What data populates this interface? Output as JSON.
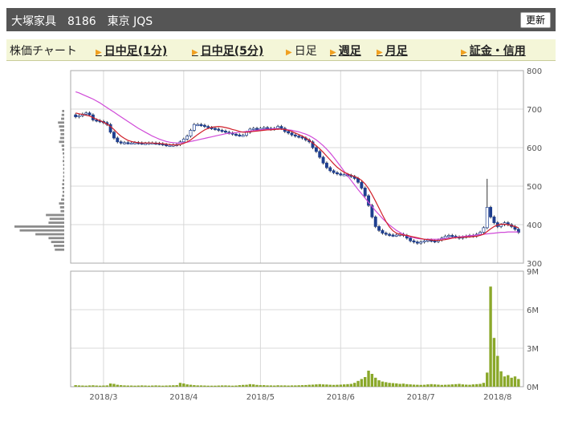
{
  "header": {
    "company": "大塚家具",
    "code": "8186",
    "market": "東京 JQS",
    "update_label": "更新"
  },
  "tabs": [
    {
      "label": "株価チャート",
      "link": false,
      "arrow": false
    },
    {
      "label": "日中足(1分)",
      "link": true,
      "arrow": true
    },
    {
      "label": "日中足(5分)",
      "link": true,
      "arrow": true
    },
    {
      "label": "日足",
      "link": false,
      "arrow": true
    },
    {
      "label": "週足",
      "link": true,
      "arrow": true
    },
    {
      "label": "月足",
      "link": true,
      "arrow": true
    },
    {
      "label": "証金・信用",
      "link": true,
      "arrow": true
    }
  ],
  "colors": {
    "up": "#ffffff",
    "down": "#1f3f8f",
    "ma_short": "#d0202a",
    "ma_long": "#d04ad8",
    "volume": "#8aa82a",
    "volume_profile": "#8c8c8c",
    "grid": "#d8d8d8"
  },
  "chart_data": [
    {
      "type": "candlestick",
      "ylim": [
        300,
        800
      ],
      "yticks": [
        "300",
        "400",
        "500",
        "600",
        "700",
        "800"
      ],
      "xticks": [
        "2018/3",
        "2018/4",
        "2018/5",
        "2018/6",
        "2018/7",
        "2018/8"
      ],
      "close": [
        680,
        683,
        687,
        690,
        685,
        672,
        670,
        668,
        665,
        660,
        640,
        625,
        615,
        612,
        613,
        612,
        612,
        613,
        612,
        611,
        611,
        612,
        612,
        611,
        610,
        608,
        606,
        606,
        607,
        608,
        615,
        622,
        630,
        645,
        660,
        660,
        658,
        655,
        652,
        650,
        648,
        645,
        643,
        640,
        638,
        635,
        633,
        632,
        632,
        640,
        648,
        650,
        649,
        650,
        652,
        650,
        648,
        650,
        655,
        650,
        642,
        638,
        633,
        630,
        628,
        625,
        620,
        615,
        600,
        590,
        575,
        560,
        548,
        540,
        535,
        532,
        530,
        530,
        528,
        525,
        520,
        510,
        495,
        475,
        450,
        420,
        395,
        385,
        378,
        375,
        373,
        372,
        373,
        375,
        372,
        365,
        358,
        355,
        352,
        355,
        358,
        360,
        358,
        356,
        360,
        365,
        370,
        372,
        370,
        368,
        365,
        368,
        370,
        372,
        370,
        375,
        380,
        392,
        445,
        420,
        405,
        395,
        400,
        405,
        400,
        395,
        388,
        380
      ],
      "ma_short": [
        690,
        688,
        686,
        684,
        682,
        678,
        674,
        670,
        666,
        661,
        655,
        647,
        638,
        630,
        624,
        619,
        616,
        614,
        613,
        612,
        612,
        612,
        612,
        611,
        611,
        610,
        609,
        608,
        607,
        607,
        608,
        611,
        615,
        620,
        627,
        634,
        640,
        646,
        650,
        653,
        654,
        655,
        654,
        652,
        650,
        647,
        645,
        642,
        640,
        640,
        641,
        642,
        643,
        644,
        645,
        646,
        646,
        647,
        648,
        648,
        647,
        645,
        642,
        638,
        634,
        630,
        625,
        619,
        612,
        605,
        597,
        588,
        578,
        568,
        558,
        549,
        542,
        536,
        532,
        528,
        525,
        521,
        515,
        506,
        494,
        478,
        461,
        443,
        425,
        408,
        394,
        384,
        378,
        375,
        373,
        372,
        370,
        368,
        366,
        364,
        362,
        361,
        360,
        359,
        359,
        360,
        361,
        363,
        365,
        366,
        367,
        367,
        368,
        368,
        369,
        370,
        372,
        375,
        382,
        389,
        395,
        399,
        401,
        401,
        400,
        398,
        395,
        392
      ],
      "ma_long": [
        745,
        742,
        738,
        734,
        730,
        726,
        721,
        716,
        710,
        704,
        698,
        692,
        686,
        680,
        674,
        668,
        662,
        656,
        650,
        645,
        640,
        635,
        630,
        626,
        622,
        619,
        616,
        614,
        613,
        612,
        612,
        613,
        614,
        616,
        618,
        620,
        622,
        624,
        626,
        628,
        630,
        632,
        634,
        636,
        637,
        638,
        639,
        640,
        641,
        642,
        643,
        644,
        645,
        646,
        647,
        648,
        648,
        649,
        649,
        648,
        647,
        646,
        645,
        643,
        641,
        638,
        635,
        631,
        626,
        620,
        613,
        605,
        596,
        586,
        575,
        563,
        551,
        539,
        527,
        515,
        503,
        491,
        480,
        469,
        458,
        447,
        436,
        426,
        416,
        407,
        399,
        392,
        385,
        380,
        375,
        371,
        368,
        366,
        364,
        363,
        362,
        362,
        362,
        362,
        362,
        363,
        364,
        365,
        366,
        367,
        368,
        369,
        370,
        371,
        372,
        373,
        374,
        375,
        376,
        377,
        378,
        379,
        380,
        380,
        381,
        381,
        381,
        381
      ]
    },
    {
      "type": "bar",
      "ylim": [
        0,
        9
      ],
      "yticks": [
        "0M",
        "3M",
        "6M",
        "9M"
      ],
      "values": [
        0.12,
        0.1,
        0.09,
        0.08,
        0.1,
        0.11,
        0.09,
        0.08,
        0.09,
        0.1,
        0.25,
        0.22,
        0.15,
        0.12,
        0.1,
        0.09,
        0.09,
        0.08,
        0.09,
        0.1,
        0.09,
        0.08,
        0.09,
        0.1,
        0.09,
        0.08,
        0.09,
        0.1,
        0.11,
        0.12,
        0.3,
        0.25,
        0.18,
        0.15,
        0.12,
        0.1,
        0.1,
        0.09,
        0.08,
        0.08,
        0.08,
        0.09,
        0.1,
        0.1,
        0.09,
        0.08,
        0.09,
        0.12,
        0.14,
        0.15,
        0.2,
        0.18,
        0.14,
        0.12,
        0.12,
        0.1,
        0.1,
        0.09,
        0.11,
        0.1,
        0.1,
        0.09,
        0.1,
        0.1,
        0.11,
        0.12,
        0.13,
        0.15,
        0.16,
        0.18,
        0.2,
        0.18,
        0.17,
        0.15,
        0.14,
        0.15,
        0.16,
        0.18,
        0.2,
        0.22,
        0.3,
        0.45,
        0.6,
        0.75,
        1.25,
        1.0,
        0.7,
        0.5,
        0.4,
        0.35,
        0.3,
        0.28,
        0.26,
        0.22,
        0.24,
        0.2,
        0.18,
        0.16,
        0.15,
        0.14,
        0.15,
        0.18,
        0.2,
        0.18,
        0.16,
        0.14,
        0.15,
        0.16,
        0.18,
        0.2,
        0.22,
        0.18,
        0.16,
        0.15,
        0.18,
        0.2,
        0.22,
        0.3,
        1.1,
        7.8,
        3.8,
        2.4,
        1.2,
        0.8,
        0.9,
        0.7,
        0.8,
        0.6
      ]
    },
    {
      "type": "volume_profile",
      "price_levels": [
        395,
        385,
        375,
        365,
        355,
        345,
        335,
        425,
        415,
        405,
        455,
        445,
        435,
        505,
        495,
        485,
        475,
        465,
        555,
        545,
        535,
        525,
        515,
        605,
        595,
        585,
        575,
        565,
        665,
        655,
        645,
        635,
        625,
        615,
        695,
        685,
        675
      ],
      "values": [
        0.95,
        0.85,
        0.55,
        0.3,
        0.25,
        0.2,
        0.18,
        0.35,
        0.28,
        0.3,
        0.1,
        0.08,
        0.07,
        0.04,
        0.04,
        0.03,
        0.04,
        0.06,
        0.02,
        0.02,
        0.02,
        0.02,
        0.03,
        0.05,
        0.04,
        0.03,
        0.02,
        0.03,
        0.12,
        0.1,
        0.08,
        0.07,
        0.08,
        0.1,
        0.04,
        0.05,
        0.06
      ]
    }
  ]
}
